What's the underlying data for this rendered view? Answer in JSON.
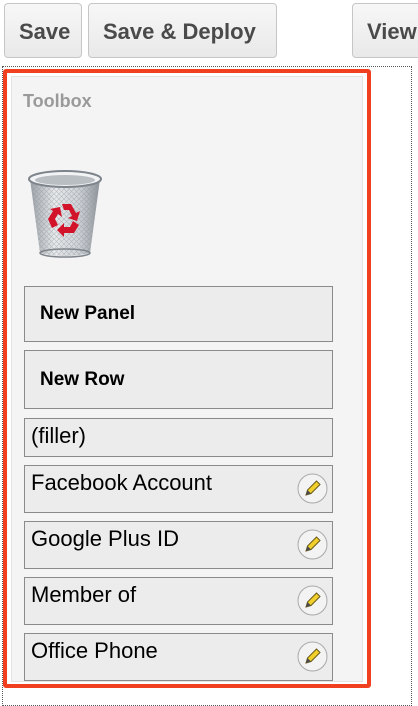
{
  "toolbar": {
    "save_label": "Save",
    "save_deploy_label": "Save & Deploy",
    "view_label": "View"
  },
  "toolbox": {
    "title": "Toolbox",
    "trash_icon": "recycle-bin-icon",
    "items": [
      {
        "label": "New Panel",
        "editable": false
      },
      {
        "label": "New Row",
        "editable": false
      },
      {
        "label": "(filler)",
        "editable": false
      },
      {
        "label": "Facebook Account",
        "editable": true
      },
      {
        "label": "Google Plus ID",
        "editable": true
      },
      {
        "label": "Member of",
        "editable": true
      },
      {
        "label": "Office Phone",
        "editable": true
      }
    ],
    "edit_icon": "pencil-icon"
  },
  "colors": {
    "highlight_border": "#f04020",
    "button_text": "#4a4a4a",
    "toolbox_title": "#9a9a9a",
    "recycle_symbol": "#d2132a"
  }
}
